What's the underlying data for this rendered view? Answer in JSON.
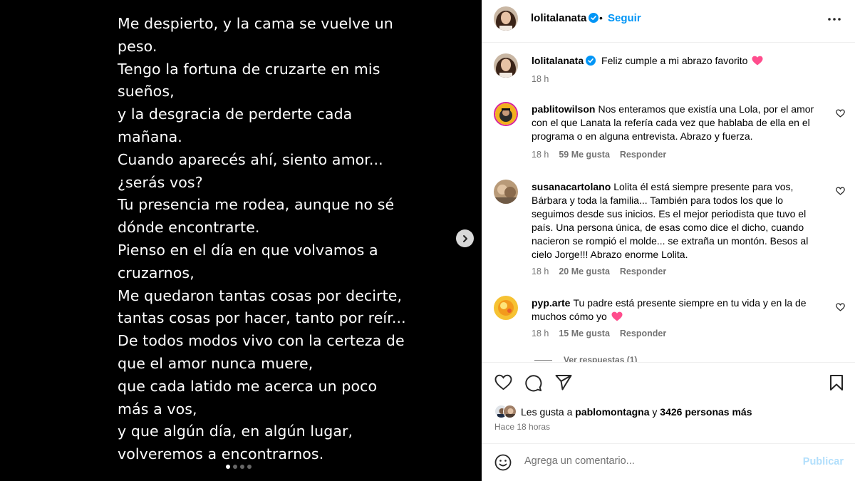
{
  "media": {
    "poem_lines": [
      "Me despierto, y la cama se vuelve un",
      "peso.",
      "Tengo la fortuna de cruzarte en mis",
      "sueños,",
      "y la desgracia de perderte cada",
      "mañana.",
      "Cuando aparecés ahí, siento amor...",
      "¿serás vos?",
      "Tu presencia me rodea, aunque no sé",
      "dónde encontrarte.",
      "Pienso en el día en que volvamos a",
      "cruzarnos,",
      "Me quedaron tantas cosas por decirte,",
      "tantas cosas por hacer, tanto por reír...",
      "De todos modos vivo con la certeza de",
      "que el amor nunca muere,",
      "que cada latido me acerca un poco",
      "más a vos,",
      "y que algún día, en algún lugar,",
      "volveremos a encontrarnos."
    ],
    "next_icon": "chevron-right-icon",
    "carousel": {
      "total": 4,
      "active": 0
    }
  },
  "header": {
    "username": "lolitalanata",
    "separator": "•",
    "follow_label": "Seguir"
  },
  "caption": {
    "username": "lolitalanata",
    "text": "Feliz cumple a mi abrazo favorito",
    "time": "18 h"
  },
  "comments": [
    {
      "username": "pablitowilson",
      "text": "Nos enteramos que existía una Lola, por el amor con el que Lanata la refería cada vez que hablaba de ella en el programa o en alguna entrevista. Abrazo y fuerza.",
      "time": "18 h",
      "likes": "59 Me gusta",
      "reply": "Responder"
    },
    {
      "username": "susanacartolano",
      "text": "Lolita él está siempre presente para vos, Bárbara y toda la familia... También para todos los que lo seguimos desde sus inicios. Es el mejor periodista que tuvo el país. Una persona única, de esas como dice el dicho, cuando nacieron se rompió el molde... se extraña un montón. Besos al cielo Jorge!!! Abrazo enorme Lolita.",
      "time": "18 h",
      "likes": "20 Me gusta",
      "reply": "Responder"
    },
    {
      "username": "pyp.arte",
      "text": "Tu padre está presente siempre en tu vida y en la de muchos cómo yo",
      "time": "18 h",
      "likes": "15 Me gusta",
      "reply": "Responder"
    }
  ],
  "view_replies": "Ver respuestas (1)",
  "likes": {
    "prefix": "Les gusta a",
    "user": "pablomontagna",
    "connector": "y",
    "others": "3426 personas más"
  },
  "posted_ago": "Hace 18 horas",
  "comment_box": {
    "placeholder": "Agrega un comentario...",
    "publish_label": "Publicar"
  },
  "colors": {
    "accent": "#0095f6",
    "heart": "#ff3040",
    "muted": "#737373",
    "publish_disabled": "#b2dffc"
  }
}
